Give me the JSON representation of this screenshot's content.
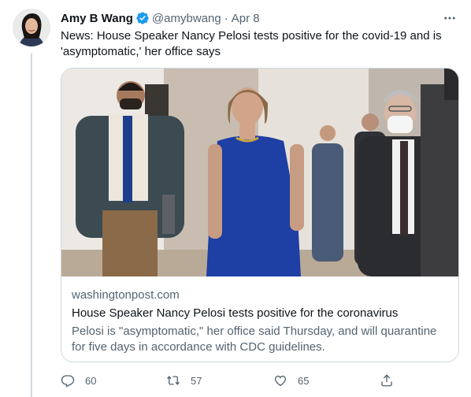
{
  "author": {
    "name": "Amy B Wang",
    "handle": "@amybwang",
    "separator": "·",
    "time": "Apr 8"
  },
  "tweet": {
    "text": "News: House Speaker Nancy Pelosi tests positive for the covid-19 and is 'asymptomatic,' her office says"
  },
  "card": {
    "domain": "washingtonpost.com",
    "title": "House Speaker Nancy Pelosi tests positive for the coronavirus",
    "description": "Pelosi is \"asymptomatic,\" her office said Thursday, and will quarantine for five days in accordance with CDC guidelines."
  },
  "actions": {
    "replies": "60",
    "retweets": "57",
    "likes": "65"
  },
  "icons": {
    "verified": "verified-badge-icon",
    "more": "more-options-icon",
    "reply": "reply-icon",
    "retweet": "retweet-icon",
    "like": "heart-icon",
    "share": "share-icon"
  },
  "colors": {
    "verified": "#1d9bf0",
    "secondary_text": "#536471",
    "border": "#cfd9de"
  }
}
